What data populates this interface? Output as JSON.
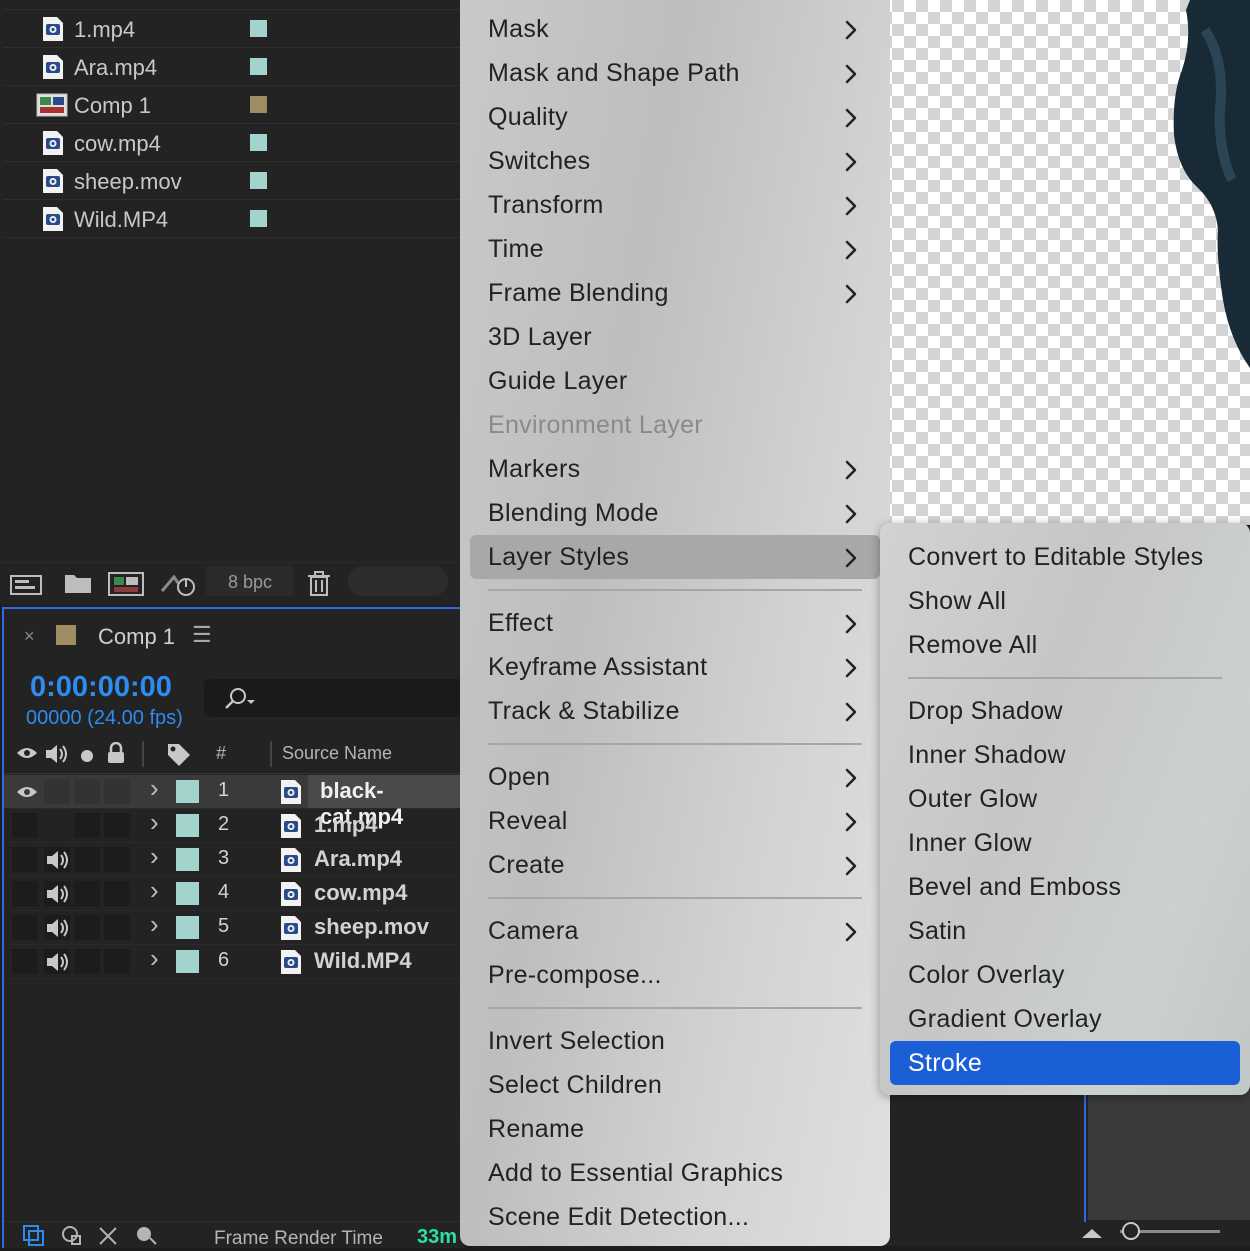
{
  "project_panel": {
    "items": [
      {
        "name": "1.mp4",
        "type": "video",
        "color": "#a3d3cd"
      },
      {
        "name": "Ara.mp4",
        "type": "video",
        "color": "#a3d3cd"
      },
      {
        "name": "Comp 1",
        "type": "composition",
        "color": "#a08c62"
      },
      {
        "name": "cow.mp4",
        "type": "video",
        "color": "#a3d3cd"
      },
      {
        "name": "sheep.mov",
        "type": "video",
        "color": "#a3d3cd"
      },
      {
        "name": "Wild.MP4",
        "type": "video",
        "color": "#a3d3cd"
      }
    ],
    "toolbar": {
      "bit_depth": "8 bpc",
      "icons": [
        "interpret-footage-icon",
        "new-folder-icon",
        "new-composition-icon",
        "flowchart-icon",
        "trash-icon"
      ]
    }
  },
  "timeline": {
    "tab_title": "Comp 1",
    "close_glyph": "×",
    "menu_glyph": "☰",
    "comp_color": "#a08c62",
    "timecode": "0:00:00:00",
    "frames": "00000 (24.00 fps)",
    "columns": {
      "number": "#",
      "source_name": "Source Name"
    },
    "layers": [
      {
        "num": "1",
        "name": "black-cat.mp4",
        "selected": true,
        "audio": false,
        "visible": true
      },
      {
        "num": "2",
        "name": "1.mp4",
        "selected": false,
        "audio": false,
        "visible": false
      },
      {
        "num": "3",
        "name": "Ara.mp4",
        "selected": false,
        "audio": true,
        "visible": false
      },
      {
        "num": "4",
        "name": "cow.mp4",
        "selected": false,
        "audio": true,
        "visible": false
      },
      {
        "num": "5",
        "name": "sheep.mov",
        "selected": false,
        "audio": true,
        "visible": false
      },
      {
        "num": "6",
        "name": "Wild.MP4",
        "selected": false,
        "audio": true,
        "visible": false
      }
    ],
    "footer": {
      "render_time_label": "Frame Render Time",
      "render_time_value": "33m"
    }
  },
  "context_menu": {
    "items": [
      {
        "label": "Mask",
        "submenu": true
      },
      {
        "label": "Mask and Shape Path",
        "submenu": true
      },
      {
        "label": "Quality",
        "submenu": true
      },
      {
        "label": "Switches",
        "submenu": true
      },
      {
        "label": "Transform",
        "submenu": true
      },
      {
        "label": "Time",
        "submenu": true
      },
      {
        "label": "Frame Blending",
        "submenu": true
      },
      {
        "label": "3D Layer",
        "submenu": false
      },
      {
        "label": "Guide Layer",
        "submenu": false
      },
      {
        "label": "Environment Layer",
        "submenu": false,
        "disabled": true
      },
      {
        "label": "Markers",
        "submenu": true
      },
      {
        "label": "Blending Mode",
        "submenu": true
      },
      {
        "label": "Layer Styles",
        "submenu": true,
        "highlighted": true
      },
      {
        "separator": true
      },
      {
        "label": "Effect",
        "submenu": true
      },
      {
        "label": "Keyframe Assistant",
        "submenu": true
      },
      {
        "label": "Track & Stabilize",
        "submenu": true
      },
      {
        "separator": true
      },
      {
        "label": "Open",
        "submenu": true
      },
      {
        "label": "Reveal",
        "submenu": true
      },
      {
        "label": "Create",
        "submenu": true
      },
      {
        "separator": true
      },
      {
        "label": "Camera",
        "submenu": true
      },
      {
        "label": "Pre-compose...",
        "submenu": false
      },
      {
        "separator": true
      },
      {
        "label": "Invert Selection",
        "submenu": false
      },
      {
        "label": "Select Children",
        "submenu": false
      },
      {
        "label": "Rename",
        "submenu": false
      },
      {
        "label": "Add to Essential Graphics",
        "submenu": false
      },
      {
        "label": "Scene Edit Detection...",
        "submenu": false
      }
    ]
  },
  "layer_styles_submenu": {
    "items": [
      {
        "label": "Convert to Editable Styles"
      },
      {
        "label": "Show All"
      },
      {
        "label": "Remove All"
      },
      {
        "separator": true
      },
      {
        "label": "Drop Shadow"
      },
      {
        "label": "Inner Shadow"
      },
      {
        "label": "Outer Glow"
      },
      {
        "label": "Inner Glow"
      },
      {
        "label": "Bevel and Emboss"
      },
      {
        "label": "Satin"
      },
      {
        "label": "Color Overlay"
      },
      {
        "label": "Gradient Overlay"
      },
      {
        "label": "Stroke",
        "active": true
      }
    ]
  },
  "colors": {
    "accent_blue": "#2e8cf0",
    "highlight_blue": "#1a5fd6",
    "render_time_green": "#2de0a0"
  }
}
